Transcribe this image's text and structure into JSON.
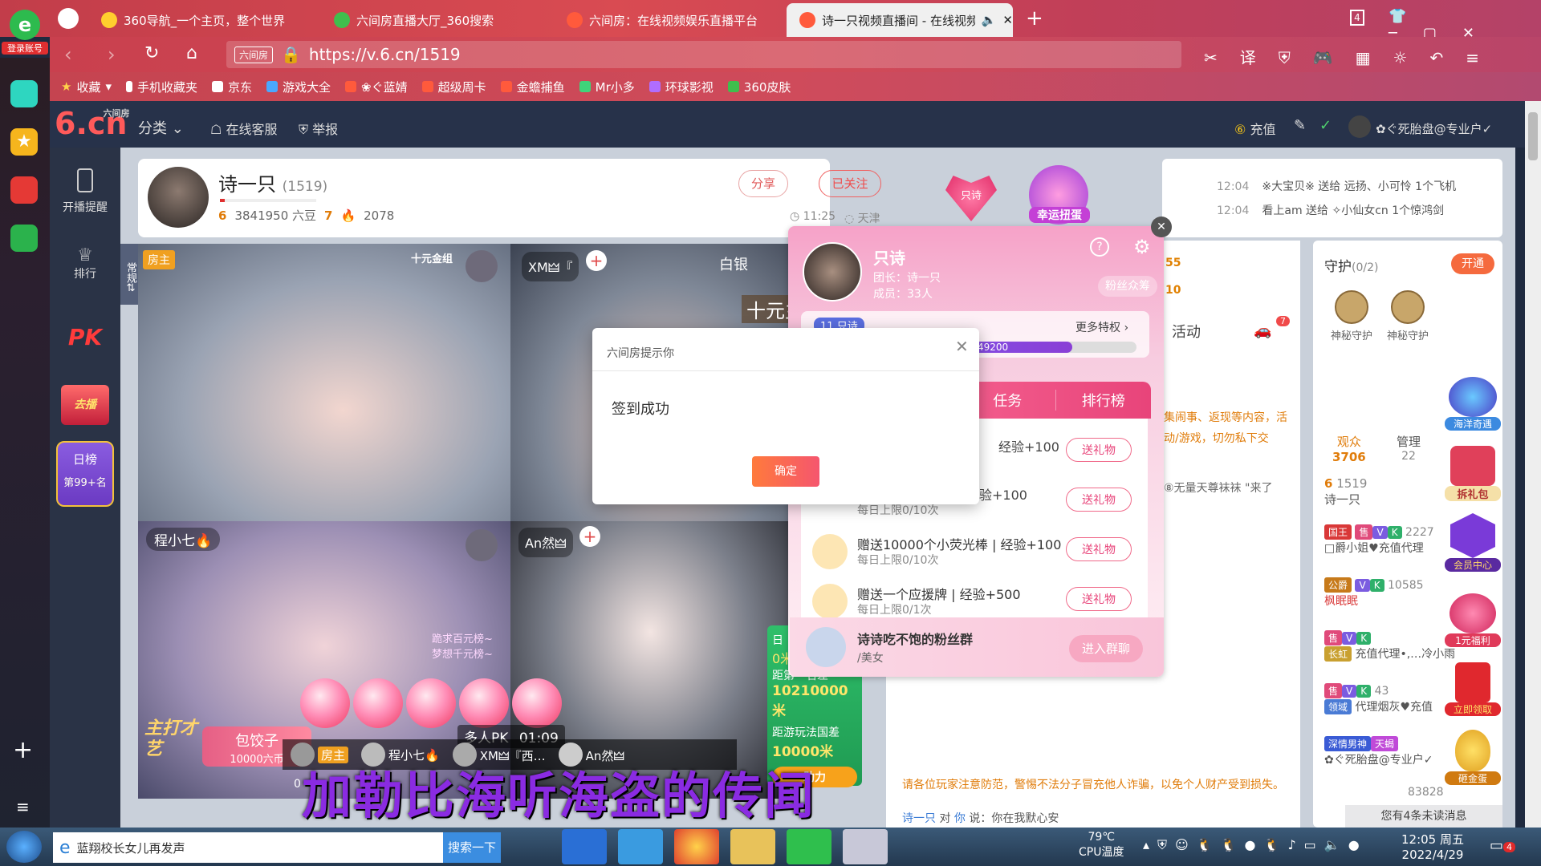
{
  "browser": {
    "tabs": [
      {
        "label": "360导航_一个主页，整个世界"
      },
      {
        "label": "六间房直播大厅_360搜索"
      },
      {
        "label": "六间房：在线视频娱乐直播平台"
      },
      {
        "label": "诗一只视频直播间 - 在线视频"
      }
    ],
    "tab_count": "4",
    "url_site_badge": "六间房",
    "url": "https://v.6.cn/1519",
    "login_label": "登录账号",
    "bookmarks": [
      "收藏",
      "手机收藏夹",
      "京东",
      "游戏大全",
      "❀ぐ蓝婧",
      "超级周卡",
      "金蟾捕鱼",
      "Mr小多",
      "环球影视",
      "360皮肤"
    ]
  },
  "site": {
    "logo": "6.cn",
    "logo_sub": "六间房",
    "nav": [
      "分类",
      "在线客服",
      "举报"
    ],
    "recharge": "充值",
    "username": "✿ぐ死胎盘@专业户✓",
    "side": [
      {
        "label": "开播提醒"
      },
      {
        "label": "排行"
      },
      {
        "label": "PK"
      },
      {
        "label": "去播"
      },
      {
        "label": "日榜"
      },
      {
        "label": "第99+名"
      }
    ]
  },
  "host": {
    "name": "诗一只",
    "room_id": "(1519)",
    "level_a": "6",
    "beans": "3841950 六豆",
    "level_b": "7",
    "heat": "2078",
    "share": "分享",
    "followed": "已关注",
    "time": "11:25",
    "location": "天津",
    "badge": "只诗",
    "lucky_egg": "幸运扭蛋"
  },
  "feed": [
    {
      "time": "12:04",
      "text": "※大宝贝※ 送给 远扬、小可怜 1个飞机"
    },
    {
      "time": "12:04",
      "text": "看上am 送给 ✧小仙女cn 1个惊鸿剑"
    }
  ],
  "videos": {
    "v1_tag": "房主",
    "v1_corner": "十元金组",
    "v2_name": "XM🜲『",
    "v2_title": "白银",
    "v2_overlay": "十元主",
    "v3_name": "程小七🔥",
    "v3_text1": "跪求百元榜~",
    "v3_text2": "梦想千元榜~",
    "v4_name": "An然🜲",
    "pk_label": "多人PK",
    "pk_timer": "01:09",
    "main_show": "主打才艺",
    "dumpling": "包饺子",
    "dumpling_cost": "10000六币",
    "participants": [
      "房主",
      "程小七🔥",
      "XM🜲『西…",
      "An然🜲"
    ],
    "zero": "0",
    "rank_box": [
      "日",
      "0米",
      "距第一名差",
      "10210000米",
      "距游玩法国差",
      "10000米",
      "助力"
    ],
    "caption": "加勒比海听海盗的传闻"
  },
  "fanclub": {
    "name": "只诗",
    "leader": "团长：诗一只",
    "members": "成员：33人",
    "fan_btn": "粉丝众筹",
    "level": "11",
    "badge": "只诗",
    "more": "更多特权",
    "progress_text": "49200",
    "progress": 0.8,
    "tabs": [
      "任务",
      "排行榜"
    ],
    "tasks": [
      {
        "title": "…",
        "exp": "经验+100",
        "limit": "",
        "btn": "送礼物"
      },
      {
        "title": "…",
        "exp": "经验+100",
        "limit": "每日上限0/10次",
        "btn": "送礼物"
      },
      {
        "title": "赠送10000个小荧光棒",
        "exp": "经验+100",
        "limit": "每日上限0/10次",
        "btn": "送礼物"
      },
      {
        "title": "赠送一个应援牌",
        "exp": "经验+500",
        "limit": "每日上限0/1次",
        "btn": "送礼物"
      }
    ],
    "group_name": "诗诗吃不饱的粉丝群",
    "group_tag": "/美女",
    "group_btn": "进入群聊"
  },
  "chat": {
    "activity_tab": "活动",
    "activity_count": "7",
    "num1": "55",
    "num2": "10",
    "notice": "集闹事、返现等内容，活动/游戏，切勿私下交",
    "entry": "⑧无量天尊袜袜 \"来了",
    "warning": "请各位玩家注意防范，警惕不法分子冒充他人诈骗，以免个人财产受到损失。",
    "last_from": "诗一只",
    "last_to": "你",
    "last_msg": "你在我默心安",
    "unread": "您有4条未读消息"
  },
  "rightpanel": {
    "guard_title": "守护",
    "guard_count": "(0/2)",
    "open_btn": "开通",
    "guards": [
      "神秘守护",
      "神秘守护"
    ],
    "audience_label": "观众",
    "audience_count": "3706",
    "manage_label": "管理",
    "manage_count": "22",
    "host_level": "6",
    "host_id": "1519",
    "host_name": "诗一只",
    "users": [
      {
        "tag": "国王",
        "name": "□爵小姐♥充值代理",
        "num": "2227"
      },
      {
        "tag": "公爵",
        "name": "枫眠眠",
        "num": "10585"
      },
      {
        "tag": "长虹",
        "name": "充值代理•,…冷小雨",
        "num": ""
      },
      {
        "tag": "领域",
        "name": "代理烟灰♥充值",
        "num": "43"
      },
      {
        "tag": "深情男神",
        "name": "✿ぐ死胎盘@专业户✓",
        "num": ""
      },
      {
        "tag": "",
        "name": "",
        "num": "83828"
      }
    ],
    "promos": [
      "海洋奇遇",
      "拆礼包",
      "会员中心",
      "1元福利",
      "立即领取",
      "砸金蛋"
    ]
  },
  "dialog": {
    "title": "六间房提示你",
    "message": "签到成功",
    "ok": "确定"
  },
  "taskbar": {
    "search_item": "蓝翔校长女儿再发声",
    "search_btn": "搜索一下",
    "temp": "79℃",
    "temp_label": "CPU温度",
    "time": "12:05 周五",
    "date": "2022/4/29",
    "notif": "4"
  }
}
